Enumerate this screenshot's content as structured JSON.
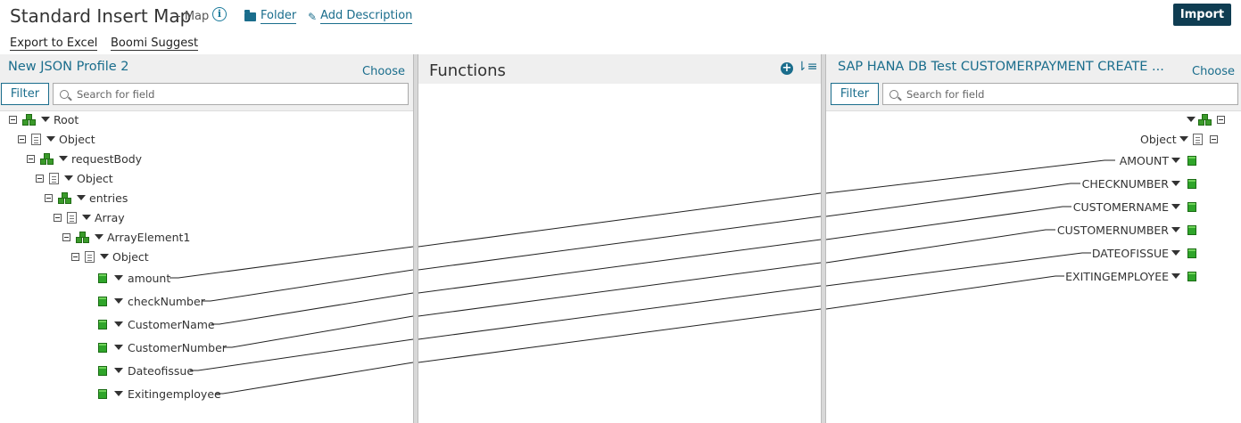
{
  "header": {
    "title": "Standard Insert Map",
    "subtitle": "- Map",
    "folder_label": "Folder",
    "add_description_label": "Add Description",
    "import_label": "Import"
  },
  "toolbar": {
    "export_label": "Export to Excel",
    "suggest_label": "Boomi Suggest"
  },
  "source": {
    "title": "New JSON Profile 2",
    "choose_label": "Choose",
    "filter_label": "Filter",
    "search_placeholder": "Search for field",
    "tree": [
      {
        "label": "Root",
        "type": "cubes"
      },
      {
        "label": "Object",
        "type": "doc"
      },
      {
        "label": "requestBody",
        "type": "cubes"
      },
      {
        "label": "Object",
        "type": "doc"
      },
      {
        "label": "entries",
        "type": "cubes"
      },
      {
        "label": "Array",
        "type": "doc"
      },
      {
        "label": "ArrayElement1",
        "type": "cubes"
      },
      {
        "label": "Object",
        "type": "doc"
      }
    ],
    "fields": [
      "amount",
      "checkNumber",
      "CustomerName",
      "CustomerNumber",
      "Dateofissue",
      "Exitingemployee"
    ]
  },
  "functions": {
    "title": "Functions"
  },
  "destination": {
    "title": "SAP HANA DB Test CUSTOMERPAYMENT CREATE ...",
    "choose_label": "Choose",
    "filter_label": "Filter",
    "search_placeholder": "Search for field",
    "object_label": "Object",
    "fields": [
      "AMOUNT",
      "CHECKNUMBER",
      "CUSTOMERNAME",
      "CUSTOMERNUMBER",
      "DATEOFISSUE",
      "EXITINGEMPLOYEE"
    ]
  },
  "colors": {
    "accent": "#1a6d8c",
    "import_button": "#0f3d52",
    "element_green": "#2fa52a"
  }
}
